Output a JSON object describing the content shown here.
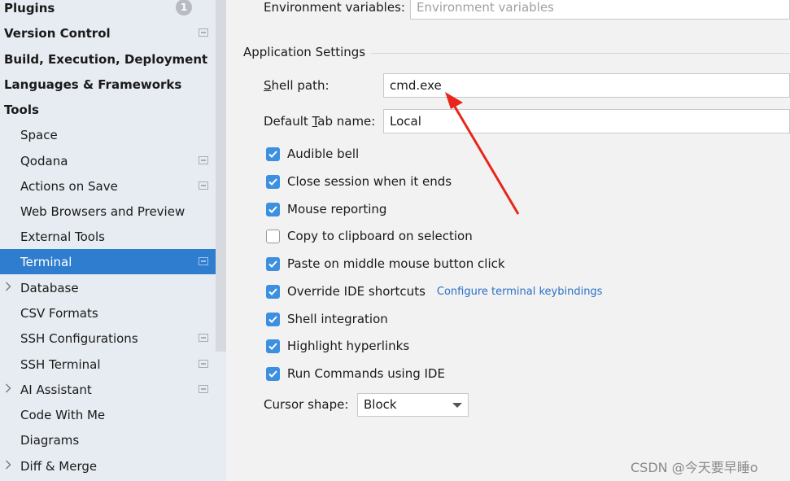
{
  "sidebar": {
    "items": [
      {
        "label": "Plugins",
        "badge": "1"
      },
      {
        "label": "Version Control"
      },
      {
        "label": "Build, Execution, Deployment"
      },
      {
        "label": "Languages & Frameworks"
      },
      {
        "label": "Tools"
      },
      {
        "label": "Space"
      },
      {
        "label": "Qodana"
      },
      {
        "label": "Actions on Save"
      },
      {
        "label": "Web Browsers and Preview"
      },
      {
        "label": "External Tools"
      },
      {
        "label": "Terminal"
      },
      {
        "label": "Database"
      },
      {
        "label": "CSV Formats"
      },
      {
        "label": "SSH Configurations"
      },
      {
        "label": "SSH Terminal"
      },
      {
        "label": "AI Assistant"
      },
      {
        "label": "Code With Me"
      },
      {
        "label": "Diagrams"
      },
      {
        "label": "Diff & Merge"
      }
    ]
  },
  "main": {
    "env_label": "Environment variables:",
    "env_placeholder": "Environment variables",
    "section_title": "Application Settings",
    "shell_path_label_mnemonic": "S",
    "shell_path_label_rest": "hell path:",
    "shell_path_value": "cmd.exe",
    "tab_name_label_prefix": "Default ",
    "tab_name_label_mnemonic": "T",
    "tab_name_label_rest": "ab name:",
    "tab_name_value": "Local",
    "checkboxes": [
      {
        "label": "Audible bell",
        "checked": true
      },
      {
        "label": "Close session when it ends",
        "checked": true
      },
      {
        "label": "Mouse reporting",
        "checked": true
      },
      {
        "label": "Copy to clipboard on selection",
        "checked": false
      },
      {
        "label": "Paste on middle mouse button click",
        "checked": true
      },
      {
        "label": "Override IDE shortcuts",
        "checked": true,
        "link": "Configure terminal keybindings"
      },
      {
        "label": "Shell integration",
        "checked": true
      },
      {
        "label": "Highlight hyperlinks",
        "checked": true
      },
      {
        "label": "Run Commands using IDE",
        "checked": true
      }
    ],
    "cursor_shape_label": "Cursor shape:",
    "cursor_shape_value": "Block"
  },
  "watermark": "CSDN @今天要早睡o",
  "colors": {
    "selection": "#2f7dcf",
    "checkbox_accent": "#3d8fe0",
    "link": "#2a70c6",
    "annotation_arrow": "#e8261c"
  }
}
